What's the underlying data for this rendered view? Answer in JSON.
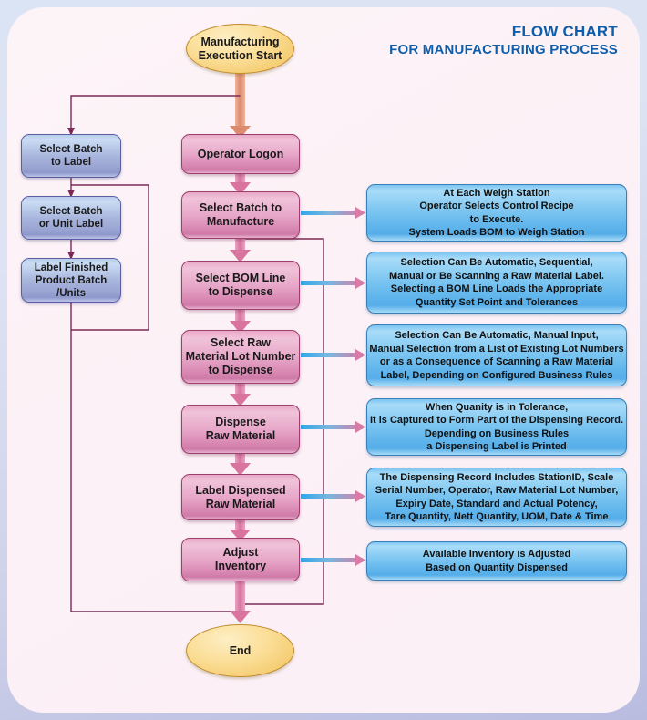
{
  "title": {
    "line1": "FLOW CHART",
    "line2": "FOR MANUFACTURING PROCESS",
    "color": "#0d5dab"
  },
  "colors": {
    "page_background_top": "#dbe4f4",
    "page_background_bottom": "#b9bcdf",
    "panel_background": "#fbf0f6",
    "terminator_fill": "#f5cd72",
    "process_fill": "#e7a6c8",
    "process_alt_fill": "#a8b6dd",
    "info_fill": "#7dc6f1",
    "connector_main": "#d97ba8",
    "connector_loop": "#7b2a55",
    "connector_info_start": "#3fa9e8",
    "connector_info_end": "#d97ba8"
  },
  "nodes": {
    "start": {
      "label": "Manufacturing\nExecution Start",
      "shape": "ellipse"
    },
    "end": {
      "label": "End",
      "shape": "ellipse"
    },
    "main": [
      {
        "id": "operator-logon",
        "label": "Operator Logon"
      },
      {
        "id": "select-batch-to-manufacture",
        "label": "Select Batch to\nManufacture"
      },
      {
        "id": "select-bom-line-to-dispense",
        "label": "Select BOM Line\nto Dispense"
      },
      {
        "id": "select-raw-material-lot-number",
        "label": "Select Raw\nMaterial Lot Number\nto Dispense"
      },
      {
        "id": "dispense-raw-material",
        "label": "Dispense\nRaw Material"
      },
      {
        "id": "label-dispensed-raw-material",
        "label": "Label Dispensed\nRaw Material"
      },
      {
        "id": "adjust-inventory",
        "label": "Adjust\nInventory"
      }
    ],
    "left": [
      {
        "id": "select-batch-to-label",
        "label": "Select Batch\nto Label"
      },
      {
        "id": "select-batch-or-unit-label",
        "label": "Select Batch\nor Unit Label"
      },
      {
        "id": "label-finished-product",
        "label": "Label Finished\nProduct Batch\n/Units"
      }
    ]
  },
  "info_boxes": [
    {
      "id": "info-weigh-station",
      "text": "At Each Weigh Station\nOperator Selects Control Recipe\nto Execute.\nSystem Loads BOM to Weigh Station"
    },
    {
      "id": "info-bom-line-selection",
      "text": "Selection Can Be Automatic, Sequential,\nManual or Be Scanning a Raw Material Label.\nSelecting a BOM Line Loads the Appropriate\nQuantity Set Point and Tolerances"
    },
    {
      "id": "info-lot-selection",
      "text": "Selection Can Be Automatic, Manual Input,\nManual Selection from a List of Existing Lot Numbers\nor as a Consequence of Scanning a Raw Material\nLabel, Depending on Configured Business Rules"
    },
    {
      "id": "info-tolerance-capture",
      "text": "When Quanity is in Tolerance,\nIt is Captured to Form Part of the Dispensing Record.\nDepending on Business Rules\na Dispensing Label is Printed"
    },
    {
      "id": "info-dispensing-record",
      "text": "The Dispensing Record Includes StationID, Scale\nSerial Number, Operator, Raw Material Lot Number,\nExpiry Date, Standard and Actual Potency,\nTare Quantity, Nett Quantity, UOM, Date & Time"
    },
    {
      "id": "info-inventory-adjust",
      "text": "Available Inventory is Adjusted\nBased on Quantity Dispensed"
    }
  ]
}
